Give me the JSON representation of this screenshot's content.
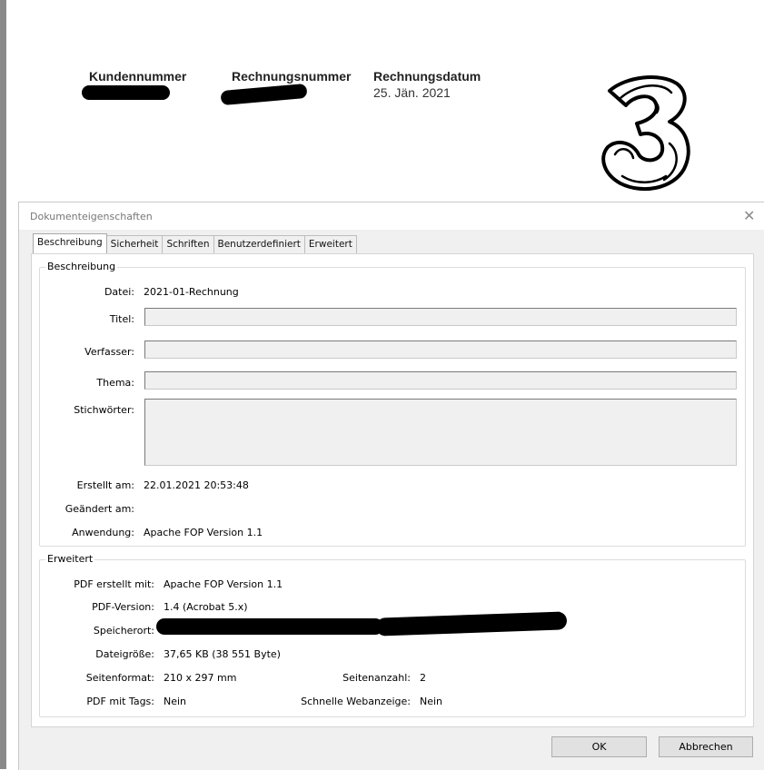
{
  "document": {
    "headers": [
      {
        "label": "Kundennummer",
        "value": ""
      },
      {
        "label": "Rechnungsnummer",
        "value": ""
      },
      {
        "label": "Rechnungsdatum",
        "value": "25. Jän. 2021"
      }
    ]
  },
  "dialog": {
    "title": "Dokumenteigenschaften",
    "tabs": [
      "Beschreibung",
      "Sicherheit",
      "Schriften",
      "Benutzerdefiniert",
      "Erweitert"
    ],
    "active_tab": "Beschreibung",
    "description": {
      "group_title": "Beschreibung",
      "datei_label": "Datei:",
      "datei_value": "2021-01-Rechnung",
      "titel_label": "Titel:",
      "titel_value": "",
      "verfasser_label": "Verfasser:",
      "verfasser_value": "",
      "thema_label": "Thema:",
      "thema_value": "",
      "stichwoerter_label": "Stichwörter:",
      "stichwoerter_value": "",
      "erstellt_label": "Erstellt am:",
      "erstellt_value": "22.01.2021 20:53:48",
      "geaendert_label": "Geändert am:",
      "geaendert_value": "",
      "anwendung_label": "Anwendung:",
      "anwendung_value": "Apache FOP Version 1.1"
    },
    "advanced": {
      "group_title": "Erweitert",
      "pdf_erstellt_label": "PDF erstellt mit:",
      "pdf_erstellt_value": "Apache FOP Version 1.1",
      "pdf_version_label": "PDF-Version:",
      "pdf_version_value": "1.4 (Acrobat 5.x)",
      "speicherort_label": "Speicherort:",
      "speicherort_value": "",
      "dateigroesse_label": "Dateigröße:",
      "dateigroesse_value": "37,65 KB (38 551 Byte)",
      "seitenformat_label": "Seitenformat:",
      "seitenformat_value": "210 x 297 mm",
      "seitenanzahl_label": "Seitenanzahl:",
      "seitenanzahl_value": "2",
      "pdf_tags_label": "PDF mit Tags:",
      "pdf_tags_value": "Nein",
      "webanzeige_label": "Schnelle Webanzeige:",
      "webanzeige_value": "Nein"
    },
    "buttons": {
      "ok": "OK",
      "cancel": "Abbrechen"
    }
  },
  "icons": {
    "close": "close-icon",
    "logo": "three-logo"
  }
}
